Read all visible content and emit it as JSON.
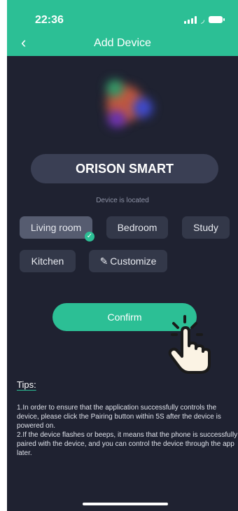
{
  "status_bar": {
    "time": "22:36"
  },
  "header": {
    "back_icon": "chevron-left-icon",
    "title": "Add Device"
  },
  "device": {
    "brand": "ORISON SMART",
    "location_caption": "Device is located"
  },
  "rooms": [
    {
      "label": "Living room",
      "selected": true
    },
    {
      "label": "Bedroom",
      "selected": false
    },
    {
      "label": "Study",
      "selected": false
    },
    {
      "label": "Kitchen",
      "selected": false
    }
  ],
  "customize": {
    "label": "Customize",
    "icon": "pencil-icon"
  },
  "confirm": {
    "label": "Confirm"
  },
  "tips": {
    "label": "Tips:",
    "text": "1.In order to ensure that the application successfully controls the device, please click the Pairing button within 5S after the device is powered on.\n2.If the device flashes or beeps, it means that the phone is successfully paired with the device, and you can control the device through the app later."
  },
  "colors": {
    "accent": "#2cbf95",
    "background": "#1f2231",
    "chip": "#333849",
    "chip_selected": "#565c70"
  }
}
